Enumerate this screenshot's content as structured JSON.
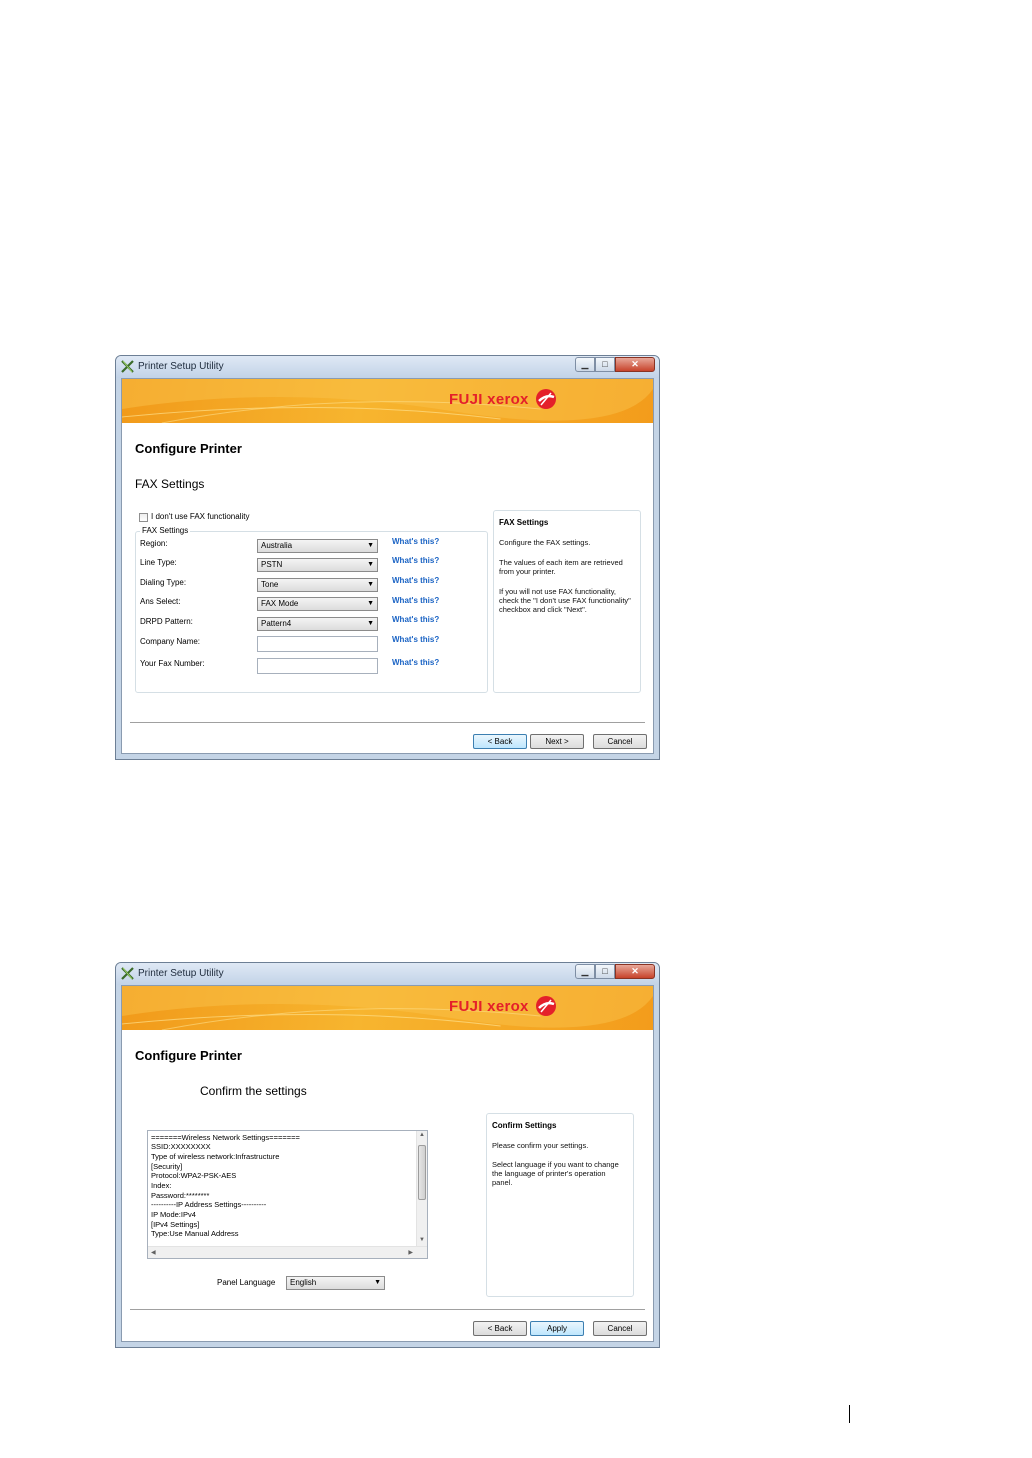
{
  "window1": {
    "title": "Printer Setup Utility",
    "brand": "FUJI xerox",
    "heading": "Configure Printer",
    "subheading": "FAX Settings",
    "checkbox_label": "I don't use FAX functionality",
    "group_label": "FAX Settings",
    "fields": [
      {
        "label": "Region:",
        "value": "Australia",
        "link": "What's this?"
      },
      {
        "label": "Line Type:",
        "value": "PSTN",
        "link": "What's this?"
      },
      {
        "label": "Dialing Type:",
        "value": "Tone",
        "link": "What's this?"
      },
      {
        "label": "Ans Select:",
        "value": "FAX Mode",
        "link": "What's this?"
      },
      {
        "label": "DRPD Pattern:",
        "value": "Pattern4",
        "link": "What's this?"
      },
      {
        "label": "Company Name:",
        "value": "",
        "link": "What's this?"
      },
      {
        "label": "Your Fax Number:",
        "value": "",
        "link": "What's this?"
      }
    ],
    "help": {
      "title": "FAX Settings",
      "p1": "Configure the FAX settings.",
      "p2": "The values of each item are retrieved from your printer.",
      "p3": "If you will not use FAX functionality, check the \"I don't use FAX functionality\" checkbox and click \"Next\"."
    },
    "buttons": {
      "back": "< Back",
      "next": "Next >",
      "cancel": "Cancel"
    }
  },
  "window2": {
    "title": "Printer Setup Utility",
    "brand": "FUJI xerox",
    "heading": "Configure Printer",
    "subheading": "Confirm the settings",
    "settings_lines": [
      "=======Wireless Network Settings=======",
      "SSID:XXXXXXXX",
      "Type of wireless network:Infrastructure",
      "[Security]",
      "Protocol:WPA2-PSK-AES",
      "Index:",
      "Password:********",
      "----------IP Address Settings----------",
      "IP Mode:IPv4",
      "[IPv4 Settings]",
      "Type:Use Manual Address"
    ],
    "panel_language_label": "Panel Language",
    "panel_language_value": "English",
    "help": {
      "title": "Confirm Settings",
      "p1": "Please confirm your settings.",
      "p2": "Select language if you want to change the language of printer's operation panel."
    },
    "buttons": {
      "back": "< Back",
      "apply": "Apply",
      "cancel": "Cancel"
    }
  },
  "colors": {
    "banner": "#f7b52f",
    "brand_red": "#e4202a",
    "link_blue": "#1a63c4",
    "title_bar": "#c4d4e6"
  },
  "icons": [
    "printer-setup-app-icon",
    "fuji-xerox-logo-icon",
    "minimize-icon",
    "maximize-icon",
    "close-icon",
    "dropdown-arrow-icon"
  ]
}
